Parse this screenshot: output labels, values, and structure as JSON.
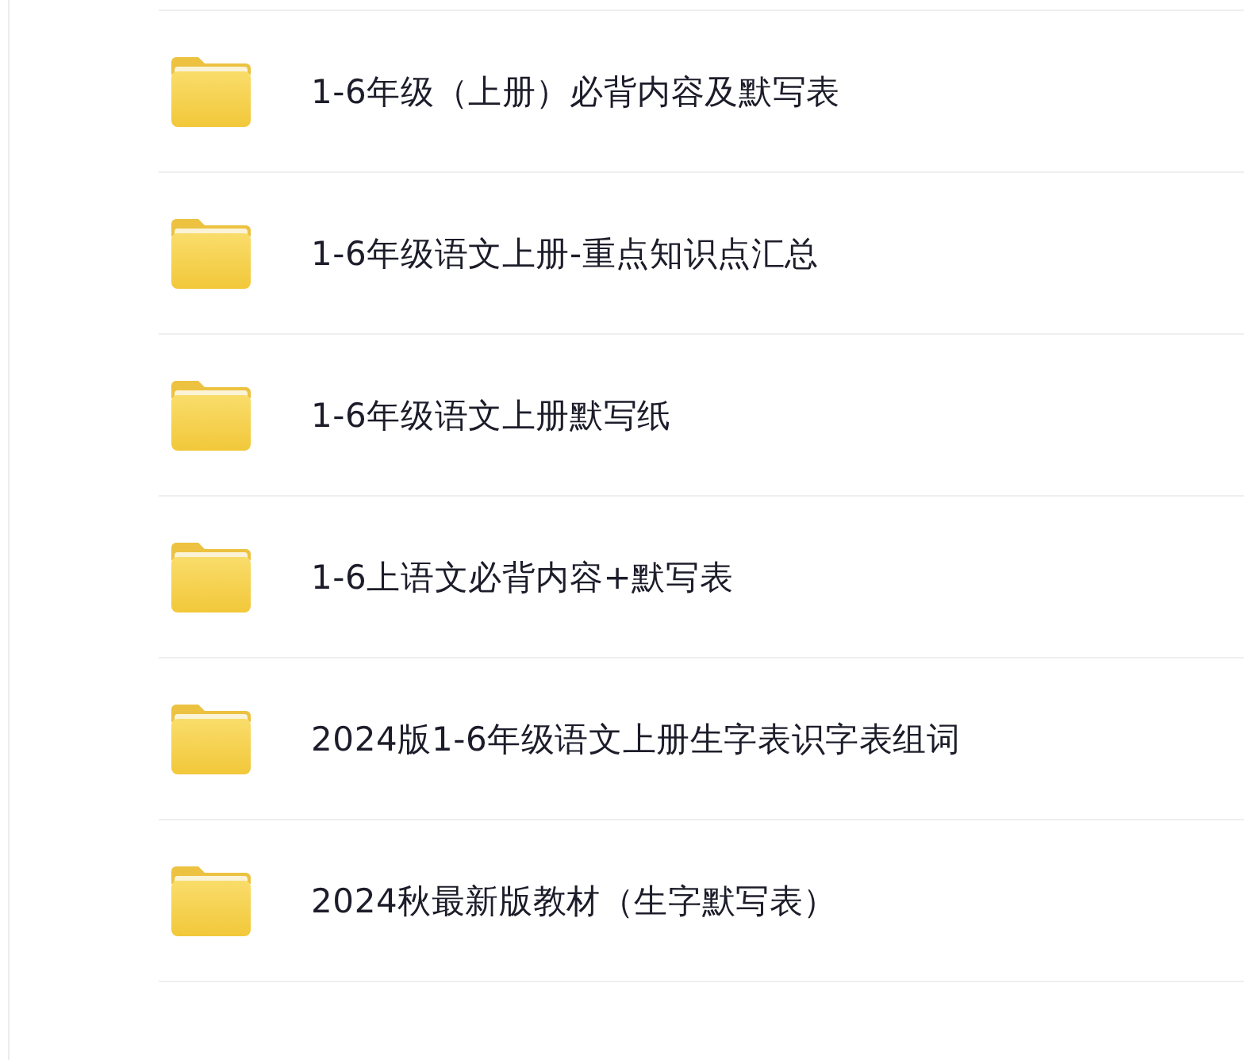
{
  "folders": [
    {
      "name": "1-6年级（上册）必背内容及默写表"
    },
    {
      "name": "1-6年级语文上册-重点知识点汇总"
    },
    {
      "name": "1-6年级语文上册默写纸"
    },
    {
      "name": "1-6上语文必背内容+默写表"
    },
    {
      "name": "2024版1-6年级语文上册生字表识字表组词"
    },
    {
      "name": "2024秋最新版教材（生字默写表）"
    }
  ]
}
